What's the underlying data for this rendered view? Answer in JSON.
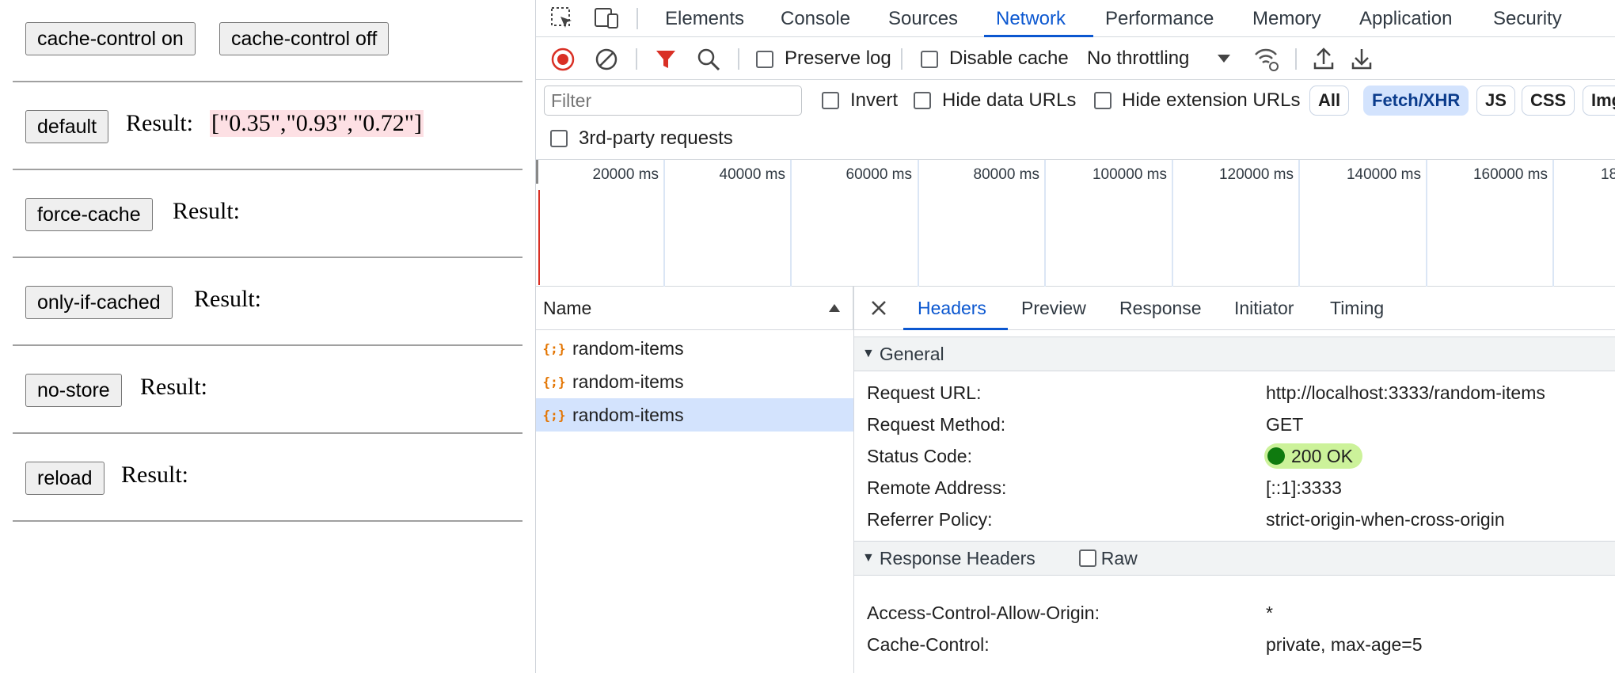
{
  "page": {
    "buttons": {
      "cache_on": "cache-control on",
      "cache_off": "cache-control off"
    },
    "rows": [
      {
        "button": "default",
        "result_label": "Result:",
        "result_value": "[\"0.35\",\"0.93\",\"0.72\"]"
      },
      {
        "button": "force-cache",
        "result_label": "Result:",
        "result_value": ""
      },
      {
        "button": "only-if-cached",
        "result_label": "Result:",
        "result_value": ""
      },
      {
        "button": "no-store",
        "result_label": "Result:",
        "result_value": ""
      },
      {
        "button": "reload",
        "result_label": "Result:",
        "result_value": ""
      }
    ]
  },
  "devtools": {
    "tabs": [
      "Elements",
      "Console",
      "Sources",
      "Network",
      "Performance",
      "Memory",
      "Application",
      "Security"
    ],
    "active_tab": "Network",
    "toolbar": {
      "preserve_log": "Preserve log",
      "disable_cache": "Disable cache",
      "throttling": "No throttling"
    },
    "filter": {
      "placeholder": "Filter",
      "invert": "Invert",
      "hide_data_urls": "Hide data URLs",
      "hide_extension_urls": "Hide extension URLs",
      "chips": [
        "All",
        "Fetch/XHR",
        "JS",
        "CSS",
        "Img"
      ],
      "selected_chip": "Fetch/XHR",
      "third_party": "3rd-party requests"
    },
    "overview": {
      "ticks": [
        "20000 ms",
        "40000 ms",
        "60000 ms",
        "80000 ms",
        "100000 ms",
        "120000 ms",
        "140000 ms",
        "160000 ms",
        "18"
      ]
    },
    "requests": {
      "column_name": "Name",
      "items": [
        "random-items",
        "random-items",
        "random-items"
      ],
      "selected_index": 2
    },
    "details": {
      "tabs": [
        "Headers",
        "Preview",
        "Response",
        "Initiator",
        "Timing"
      ],
      "active_tab": "Headers",
      "general_title": "General",
      "general": [
        {
          "key": "Request URL:",
          "value": "http://localhost:3333/random-items"
        },
        {
          "key": "Request Method:",
          "value": "GET"
        },
        {
          "key": "Status Code:",
          "value": "200 OK"
        },
        {
          "key": "Remote Address:",
          "value": "[::1]:3333"
        },
        {
          "key": "Referrer Policy:",
          "value": "strict-origin-when-cross-origin"
        }
      ],
      "response_title": "Response Headers",
      "raw_label": "Raw",
      "response": [
        {
          "key": "Access-Control-Allow-Origin:",
          "value": "*"
        },
        {
          "key": "Cache-Control:",
          "value": "private, max-age=5"
        }
      ]
    },
    "colors": {
      "accent": "#0b57d0",
      "record_red": "#d93025",
      "status_green": "#0f7a0f"
    }
  }
}
